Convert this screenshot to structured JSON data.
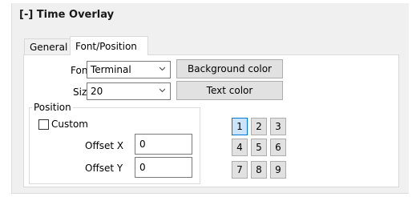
{
  "section": {
    "title": "[-] Time Overlay"
  },
  "tabs": [
    {
      "label": "General"
    },
    {
      "label": "Font/Position"
    }
  ],
  "font": {
    "label": "Font",
    "value": "Terminal"
  },
  "size": {
    "label": "Size",
    "value": "20"
  },
  "buttons": {
    "background_color": "Background color",
    "text_color": "Text color"
  },
  "position": {
    "group_label": "Position",
    "custom_label": "Custom",
    "custom_checked": false,
    "offset_x_label": "Offset X",
    "offset_x_value": "0",
    "offset_y_label": "Offset Y",
    "offset_y_value": "0",
    "anchor_grid": [
      "1",
      "2",
      "3",
      "4",
      "5",
      "6",
      "7",
      "8",
      "9"
    ],
    "selected_anchor": "1"
  },
  "colors": {
    "panel_bg": "#f0f0f0",
    "selected_button_bg": "#cce4f7",
    "selected_button_border": "#0078d7"
  }
}
